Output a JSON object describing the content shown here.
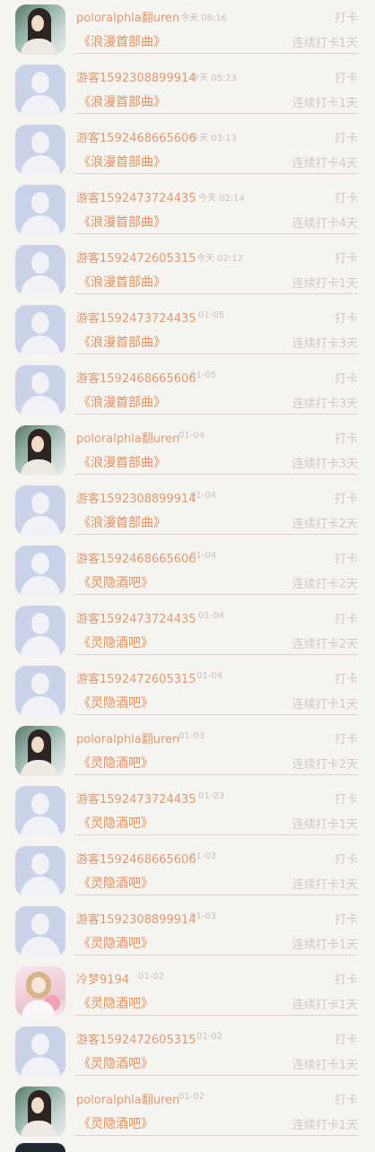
{
  "checkin_list": {
    "rows": [
      {
        "username": "poloralphla翻uren",
        "time": "今天 08:16",
        "action": "打卡",
        "track": "《浪漫首部曲》",
        "streak": "连续打卡1天",
        "avatar": "photo-a"
      },
      {
        "username": "游客1592308899914",
        "time": "今天 05:23",
        "action": "打卡",
        "track": "《浪漫首部曲》",
        "streak": "连续打卡1天",
        "avatar": "default"
      },
      {
        "username": "游客1592468665606",
        "time": "今天 03:13",
        "action": "打卡",
        "track": "《浪漫首部曲》",
        "streak": "连续打卡4天",
        "avatar": "default"
      },
      {
        "username": "游客1592473724435",
        "time": "今天 02:14",
        "action": "打卡",
        "track": "《浪漫首部曲》",
        "streak": "连续打卡4天",
        "avatar": "default"
      },
      {
        "username": "游客1592472605315",
        "time": "今天 02:12",
        "action": "打卡",
        "track": "《浪漫首部曲》",
        "streak": "连续打卡1天",
        "avatar": "default"
      },
      {
        "username": "游客1592473724435",
        "time": "01-05",
        "action": "打卡",
        "track": "《浪漫首部曲》",
        "streak": "连续打卡3天",
        "avatar": "default"
      },
      {
        "username": "游客1592468665606",
        "time": "01-05",
        "action": "打卡",
        "track": "《浪漫首部曲》",
        "streak": "连续打卡3天",
        "avatar": "default"
      },
      {
        "username": "poloralphla翻uren",
        "time": "01-04",
        "action": "打卡",
        "track": "《浪漫首部曲》",
        "streak": "连续打卡3天",
        "avatar": "photo-a"
      },
      {
        "username": "游客1592308899914",
        "time": "01-04",
        "action": "打卡",
        "track": "《浪漫首部曲》",
        "streak": "连续打卡2天",
        "avatar": "default"
      },
      {
        "username": "游客1592468665606",
        "time": "01-04",
        "action": "打卡",
        "track": "《灵隐酒吧》",
        "streak": "连续打卡2天",
        "avatar": "default"
      },
      {
        "username": "游客1592473724435",
        "time": "01-04",
        "action": "打卡",
        "track": "《灵隐酒吧》",
        "streak": "连续打卡2天",
        "avatar": "default"
      },
      {
        "username": "游客1592472605315",
        "time": "01-04",
        "action": "打卡",
        "track": "《灵隐酒吧》",
        "streak": "连续打卡1天",
        "avatar": "default"
      },
      {
        "username": "poloralphla翻uren",
        "time": "01-03",
        "action": "打卡",
        "track": "《灵隐酒吧》",
        "streak": "连续打卡2天",
        "avatar": "photo-a"
      },
      {
        "username": "游客1592473724435",
        "time": "01-03",
        "action": "打卡",
        "track": "《灵隐酒吧》",
        "streak": "连续打卡1天",
        "avatar": "default"
      },
      {
        "username": "游客1592468665606",
        "time": "01-03",
        "action": "打卡",
        "track": "《灵隐酒吧》",
        "streak": "连续打卡1天",
        "avatar": "default"
      },
      {
        "username": "游客1592308899914",
        "time": "01-03",
        "action": "打卡",
        "track": "《灵隐酒吧》",
        "streak": "连续打卡1天",
        "avatar": "default"
      },
      {
        "username": "冷梦9194",
        "time": "01-02",
        "action": "打卡",
        "track": "《灵隐酒吧》",
        "streak": "连续打卡1天",
        "avatar": "photo-b"
      },
      {
        "username": "游客1592472605315",
        "time": "01-02",
        "action": "打卡",
        "track": "《灵隐酒吧》",
        "streak": "连续打卡1天",
        "avatar": "default"
      },
      {
        "username": "poloralphla翻uren",
        "time": "01-02",
        "action": "打卡",
        "track": "《灵隐酒吧》",
        "streak": "连续打卡1天",
        "avatar": "photo-a"
      }
    ]
  }
}
